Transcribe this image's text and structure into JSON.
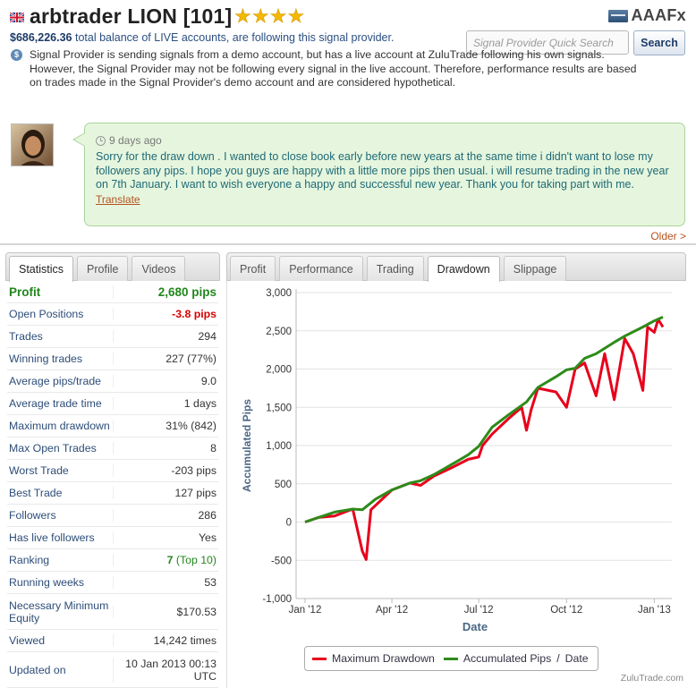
{
  "header": {
    "provider_name": "arbtrader LION [101]",
    "stars": "★★★★",
    "brand": "AAAFx",
    "balance_amount": "$686,226.36",
    "balance_text": "total balance of LIVE accounts, are following this signal provider.",
    "disclaimer": "Signal Provider is sending signals from a demo account, but has a live account at ZuluTrade following his own signals. However, the Signal Provider may not be following every signal in the live account. Therefore, performance results are based on trades made in the Signal Provider's demo account and are considered hypothetical.",
    "search_placeholder": "Signal Provider Quick Search",
    "search_button": "Search"
  },
  "message": {
    "time": "9 days ago",
    "text": "Sorry for the draw down . I wanted to close book early before new years at the same time i didn't want to lose my followers any pips. I hope you guys are happy with a little more pips then usual. i will resume trading in the new year on 7th January. I want to wish everyone a happy and successful new year. Thank you for taking part with me.",
    "translate": "Translate",
    "older": "Older >"
  },
  "left_tabs": [
    "Statistics",
    "Profile",
    "Videos"
  ],
  "stats": [
    {
      "label": "Profit",
      "value": "2,680 pips"
    },
    {
      "label": "Open Positions",
      "value": "-3.8 pips"
    },
    {
      "label": "Trades",
      "value": "294"
    },
    {
      "label": "Winning trades",
      "value": "227 (77%)"
    },
    {
      "label": "Average pips/trade",
      "value": "9.0"
    },
    {
      "label": "Average trade time",
      "value": "1 days"
    },
    {
      "label": "Maximum drawdown",
      "value": "31% (842)"
    },
    {
      "label": "Max Open Trades",
      "value": "8"
    },
    {
      "label": "Worst Trade",
      "value": "-203 pips"
    },
    {
      "label": "Best Trade",
      "value": "127 pips"
    },
    {
      "label": "Followers",
      "value": "286"
    },
    {
      "label": "Has live followers",
      "value": "Yes"
    },
    {
      "label": "Ranking",
      "value": "7",
      "value_suffix": "(Top 10)"
    },
    {
      "label": "Running weeks",
      "value": "53"
    },
    {
      "label": "Necessary Minimum Equity",
      "value": "$170.53"
    },
    {
      "label": "Viewed",
      "value": "14,242 times"
    },
    {
      "label": "Updated on",
      "value": "10 Jan 2013 00:13 UTC"
    }
  ],
  "right_tabs": [
    "Profit",
    "Performance",
    "Trading",
    "Drawdown",
    "Slippage"
  ],
  "legend": {
    "series1": "Maximum Drawdown",
    "series2": "Accumulated Pips",
    "separator": "/",
    "series3": "Date"
  },
  "watermark": "ZuluTrade.com",
  "colors": {
    "drawdown": "#e8001b",
    "accumulated": "#2e8b1a",
    "link": "#b3521f"
  },
  "chart_data": {
    "type": "line",
    "xlabel": "Date",
    "ylabel": "Accumulated Pips",
    "x_ticks": [
      "Jan '12",
      "Apr '12",
      "Jul '12",
      "Oct '12",
      "Jan '13"
    ],
    "y_ticks": [
      3000,
      2500,
      2000,
      1500,
      1000,
      500,
      0,
      -500,
      -1000
    ],
    "ylim": [
      -1000,
      3000
    ],
    "xlim": [
      "2012-01-01",
      "2013-01-10"
    ],
    "grid": "horizontal",
    "series": [
      {
        "name": "Accumulated Pips",
        "points": [
          [
            "2012-01-01",
            0
          ],
          [
            "2012-01-15",
            60
          ],
          [
            "2012-02-01",
            130
          ],
          [
            "2012-02-20",
            170
          ],
          [
            "2012-03-01",
            160
          ],
          [
            "2012-03-15",
            300
          ],
          [
            "2012-04-01",
            420
          ],
          [
            "2012-04-20",
            510
          ],
          [
            "2012-05-01",
            540
          ],
          [
            "2012-05-15",
            620
          ],
          [
            "2012-06-01",
            740
          ],
          [
            "2012-06-20",
            880
          ],
          [
            "2012-07-01",
            990
          ],
          [
            "2012-07-15",
            1240
          ],
          [
            "2012-08-01",
            1400
          ],
          [
            "2012-08-20",
            1570
          ],
          [
            "2012-09-01",
            1760
          ],
          [
            "2012-09-20",
            1900
          ],
          [
            "2012-10-01",
            1990
          ],
          [
            "2012-10-10",
            2010
          ],
          [
            "2012-10-20",
            2140
          ],
          [
            "2012-11-01",
            2200
          ],
          [
            "2012-11-20",
            2350
          ],
          [
            "2012-12-01",
            2430
          ],
          [
            "2012-12-20",
            2550
          ],
          [
            "2013-01-01",
            2630
          ],
          [
            "2013-01-10",
            2680
          ]
        ]
      },
      {
        "name": "Maximum Drawdown",
        "points": [
          [
            "2012-01-01",
            0
          ],
          [
            "2012-01-15",
            60
          ],
          [
            "2012-02-01",
            80
          ],
          [
            "2012-02-20",
            170
          ],
          [
            "2012-03-01",
            -380
          ],
          [
            "2012-03-05",
            -490
          ],
          [
            "2012-03-10",
            160
          ],
          [
            "2012-04-01",
            420
          ],
          [
            "2012-04-20",
            510
          ],
          [
            "2012-05-01",
            480
          ],
          [
            "2012-05-15",
            600
          ],
          [
            "2012-06-01",
            700
          ],
          [
            "2012-06-20",
            820
          ],
          [
            "2012-07-01",
            850
          ],
          [
            "2012-07-05",
            1000
          ],
          [
            "2012-07-15",
            1150
          ],
          [
            "2012-08-01",
            1350
          ],
          [
            "2012-08-15",
            1500
          ],
          [
            "2012-08-20",
            1200
          ],
          [
            "2012-08-25",
            1470
          ],
          [
            "2012-09-01",
            1750
          ],
          [
            "2012-09-20",
            1700
          ],
          [
            "2012-10-01",
            1500
          ],
          [
            "2012-10-10",
            2000
          ],
          [
            "2012-10-20",
            2080
          ],
          [
            "2012-11-01",
            1650
          ],
          [
            "2012-11-10",
            2200
          ],
          [
            "2012-11-20",
            1600
          ],
          [
            "2012-12-01",
            2400
          ],
          [
            "2012-12-10",
            2200
          ],
          [
            "2012-12-20",
            1720
          ],
          [
            "2012-12-25",
            2550
          ],
          [
            "2013-01-01",
            2480
          ],
          [
            "2013-01-05",
            2650
          ],
          [
            "2013-01-10",
            2550
          ]
        ]
      }
    ]
  }
}
